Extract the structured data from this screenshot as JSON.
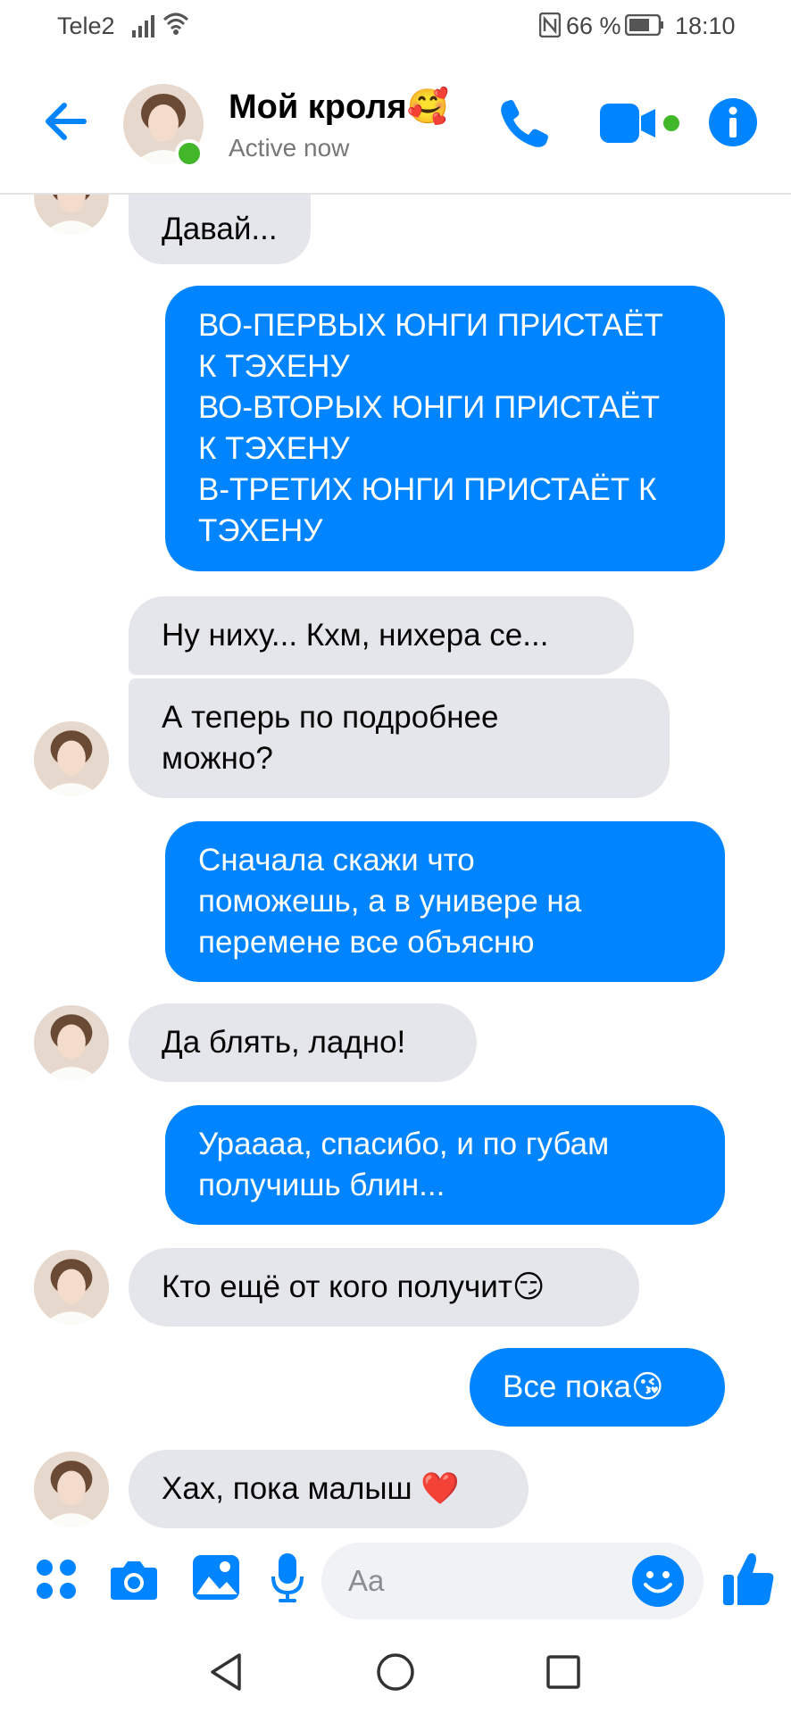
{
  "status_bar": {
    "carrier": "Tele2",
    "battery_percent": "66 %",
    "time": "18:10"
  },
  "header": {
    "contact_name": "Мой кроля🥰",
    "status": "Active now",
    "icons": [
      "back-arrow-icon",
      "phone-icon",
      "video-camera-icon",
      "info-icon"
    ],
    "accent_color": "#0084ff",
    "online_color": "#42b72a"
  },
  "messages": [
    {
      "from": "contact",
      "text": "Давай..."
    },
    {
      "from": "me",
      "lines": [
        "ВО-ПЕРВЫХ ЮНГИ ПРИСТАЁТ",
        "К ТЭХЕНУ",
        "ВО-ВТОРЫХ ЮНГИ ПРИСТАЁТ",
        "К ТЭХЕНУ",
        "В-ТРЕТИХ ЮНГИ ПРИСТАЁТ К",
        "ТЭХЕНУ"
      ]
    },
    {
      "from": "contact",
      "text": "Ну ниху... Кхм, нихера се..."
    },
    {
      "from": "contact",
      "lines": [
        "А теперь по подробнее",
        "можно?"
      ]
    },
    {
      "from": "me",
      "lines": [
        "Сначала скажи что",
        "поможешь, а в универе на",
        "перемене все объясню"
      ]
    },
    {
      "from": "contact",
      "text": "Да блять, ладно!"
    },
    {
      "from": "me",
      "lines": [
        "Ураааа, спасибо, и по губам",
        "получишь блин..."
      ]
    },
    {
      "from": "contact",
      "text": "Кто ещё от кого получит😏"
    },
    {
      "from": "me",
      "text": "Все пока😘"
    },
    {
      "from": "contact",
      "text": "Хах, пока малыш ❤️"
    }
  ],
  "composer": {
    "placeholder": "Aa",
    "icons": [
      "apps-icon",
      "camera-icon",
      "gallery-icon",
      "microphone-icon",
      "emoji-icon",
      "thumbs-up-icon"
    ]
  },
  "nav_bar": {
    "icons": [
      "nav-back-icon",
      "nav-home-icon",
      "nav-recents-icon"
    ]
  },
  "colors": {
    "outgoing_bubble": "#0084ff",
    "incoming_bubble": "#e4e6eb"
  }
}
